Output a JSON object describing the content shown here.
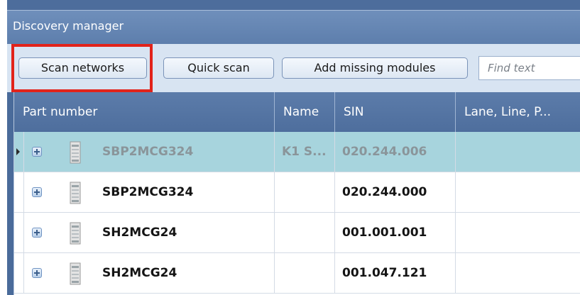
{
  "window": {
    "title": "Discovery manager"
  },
  "toolbar": {
    "scan_label": "Scan networks",
    "quick_label": "Quick scan",
    "add_label": "Add missing modules",
    "search_placeholder": "Find text"
  },
  "grid": {
    "columns": [
      "Part number",
      "Name",
      "SIN",
      "Lane, Line, P..."
    ],
    "rows": [
      {
        "part": "SBP2MCG324",
        "name": "K1 S...",
        "sin": "020.244.006",
        "lane": "",
        "selected": true
      },
      {
        "part": "SBP2MCG324",
        "name": "",
        "sin": "020.244.000",
        "lane": "",
        "selected": false
      },
      {
        "part": "SH2MCG24",
        "name": "",
        "sin": "001.001.001",
        "lane": "",
        "selected": false
      },
      {
        "part": "SH2MCG24",
        "name": "",
        "sin": "001.047.121",
        "lane": "",
        "selected": false
      }
    ]
  },
  "icons": {
    "row_indicator": "row-pointer-icon",
    "expand": "expand-plus-icon",
    "module": "din-module-icon"
  },
  "colors": {
    "highlight": "#e2231a",
    "selected_row": "#a7d4dd",
    "header": "#5274a3"
  }
}
